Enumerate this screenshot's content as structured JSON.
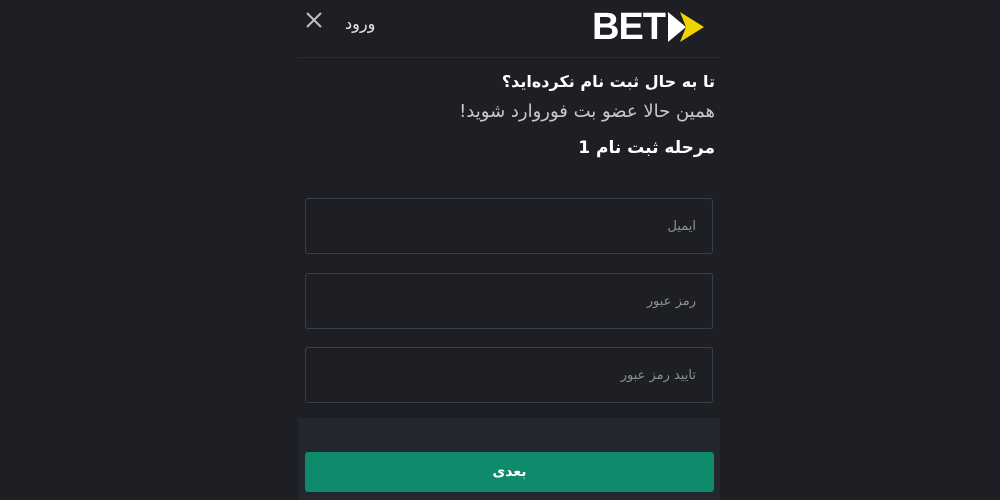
{
  "header": {
    "login_label": "ورود",
    "logo_text": "BET",
    "close_icon": "close-icon",
    "logo_arrow_color": "#f0d400"
  },
  "intro": {
    "question": "تا به حال ثبت نام نکرده‌اید؟",
    "join_text": "همین حالا عضو بت فوروارد شوید!",
    "step_title": "مرحله ثبت نام 1"
  },
  "form": {
    "email_placeholder": "ایمیل",
    "password_placeholder": "رمز عبور",
    "confirm_placeholder": "تأیید رمز عبور"
  },
  "footer": {
    "next_label": "بعدی",
    "button_color": "#0e8a6d"
  }
}
